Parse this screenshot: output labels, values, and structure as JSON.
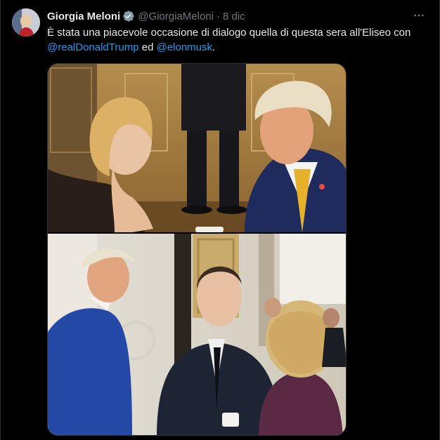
{
  "tweet": {
    "author_name": "Giorgia Meloni",
    "handle": "@GiorgiaMeloni",
    "separator": "·",
    "time": "8 dic",
    "text_part1": "È stata una piacevole occasione di dialogo quella di questa sera all'Eliseo con ",
    "mention_1": "@realDonaldTrump",
    "text_part2": " ed ",
    "mention_2": "@elonmusk",
    "text_part3": "."
  },
  "icons": {
    "verified": "verified-badge-icon",
    "more": "more-options-icon"
  },
  "colors": {
    "background": "#000000",
    "text": "#e7e9ea",
    "muted": "#71767b",
    "link": "#1d9bf0",
    "border": "#2f3336"
  }
}
